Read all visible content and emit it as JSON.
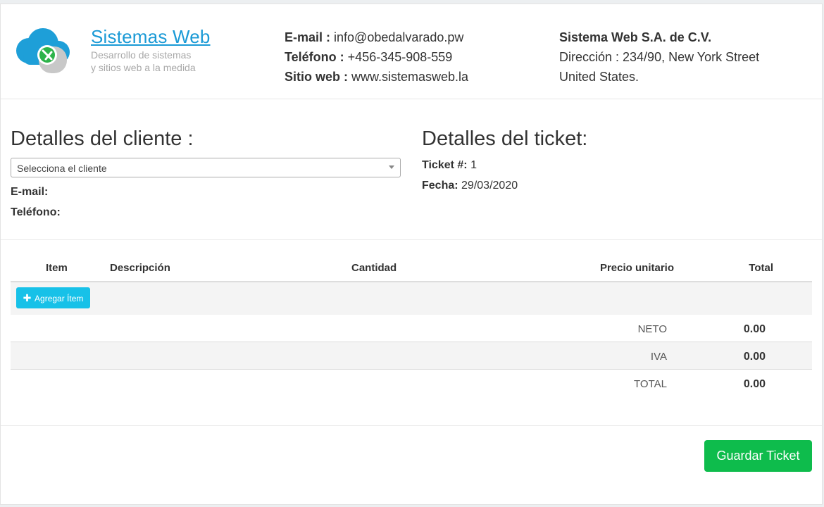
{
  "brand": {
    "name": "Sistemas Web",
    "tagline_line1": "Desarrollo de sistemas",
    "tagline_line2": "y sitios web a la medida"
  },
  "contact": {
    "email_label": "E-mail :",
    "email_value": "info@obedalvarado.pw",
    "phone_label": "Teléfono :",
    "phone_value": "+456-345-908-559",
    "web_label": "Sitio web :",
    "web_value": "www.sistemasweb.la"
  },
  "company": {
    "name": "Sistema Web S.A. de C.V.",
    "address": "Dirección : 234/90, New York Street",
    "country": "United States."
  },
  "client": {
    "title": "Detalles del cliente :",
    "select_value": "Selecciona el cliente",
    "email_label": "E-mail:",
    "phone_label": "Teléfono:"
  },
  "ticket": {
    "title": "Detalles del ticket:",
    "number_label": "Ticket #:",
    "number_value": "1",
    "date_label": "Fecha:",
    "date_value": "29/03/2020"
  },
  "table": {
    "headers": {
      "item": "Item",
      "description": "Descripción",
      "quantity": "Cantidad",
      "unit_price": "Precio unitario",
      "total": "Total"
    },
    "add_item_label": "Agregar Ítem"
  },
  "summary": {
    "neto_label": "NETO",
    "neto_value": "0.00",
    "iva_label": "IVA",
    "iva_value": "0.00",
    "total_label": "TOTAL",
    "total_value": "0.00"
  },
  "actions": {
    "save_label": "Guardar Ticket"
  },
  "colors": {
    "brand_blue": "#1a9ad6",
    "add_button": "#17c1e8",
    "save_button": "#0ebc4c"
  }
}
